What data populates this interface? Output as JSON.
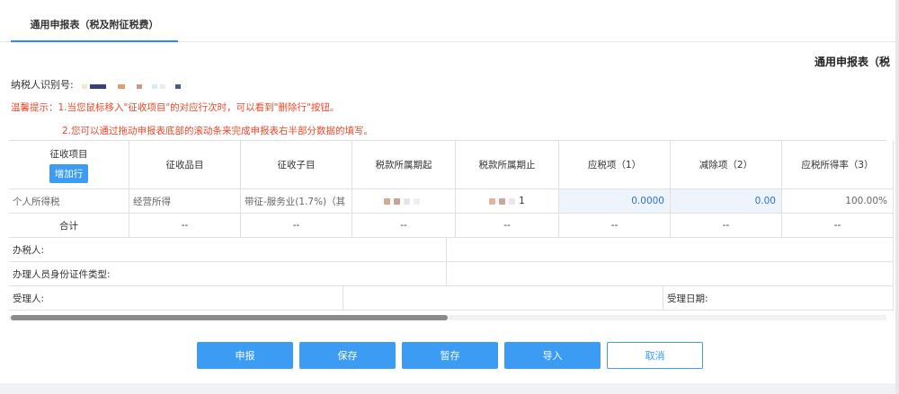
{
  "tab": {
    "label": "通用申报表（税及附征税费）"
  },
  "form_title": "通用申报表（税",
  "taxpayer": {
    "id_label": "纳税人识别号:"
  },
  "hints": {
    "line1": "温馨提示：1.当您鼠标移入\"征收项目\"的对应行次时，可以看到\"删除行\"按钮。",
    "line2": "2.您可以通过拖动申报表底部的滚动条来完成申报表右半部分数据的填写。"
  },
  "table": {
    "headers": {
      "col1": "征收项目",
      "add_row": "增加行",
      "col2": "征收品目",
      "col3": "征收子目",
      "col4": "税款所属期起",
      "col5": "税款所属期止",
      "col6": "应税项（1）",
      "col7": "减除项（2）",
      "col8": "应税所得率（3）"
    },
    "row1": {
      "project": "个人所得税",
      "item": "经营所得",
      "subitem": "带征-服务业(1.7%)（其",
      "period_end_tail": "1",
      "taxable": "0.0000",
      "deduction": "0.00",
      "rate": "100.00%"
    },
    "total": {
      "label": "合计",
      "dash": "--"
    },
    "agent_label": "办税人:",
    "agent_id_label": "办理人员身份证件类型:",
    "receiver_label": "受理人:",
    "receive_date_label": "受理日期:"
  },
  "buttons": {
    "declare": "申报",
    "save": "保存",
    "temp_save": "暂存",
    "import": "导入",
    "cancel": "取消"
  },
  "colors": {
    "accent": "#3c9cf4",
    "hint": "#e8492a",
    "editable_bg": "#eef4fb",
    "editable_text": "#2d6fd6"
  }
}
